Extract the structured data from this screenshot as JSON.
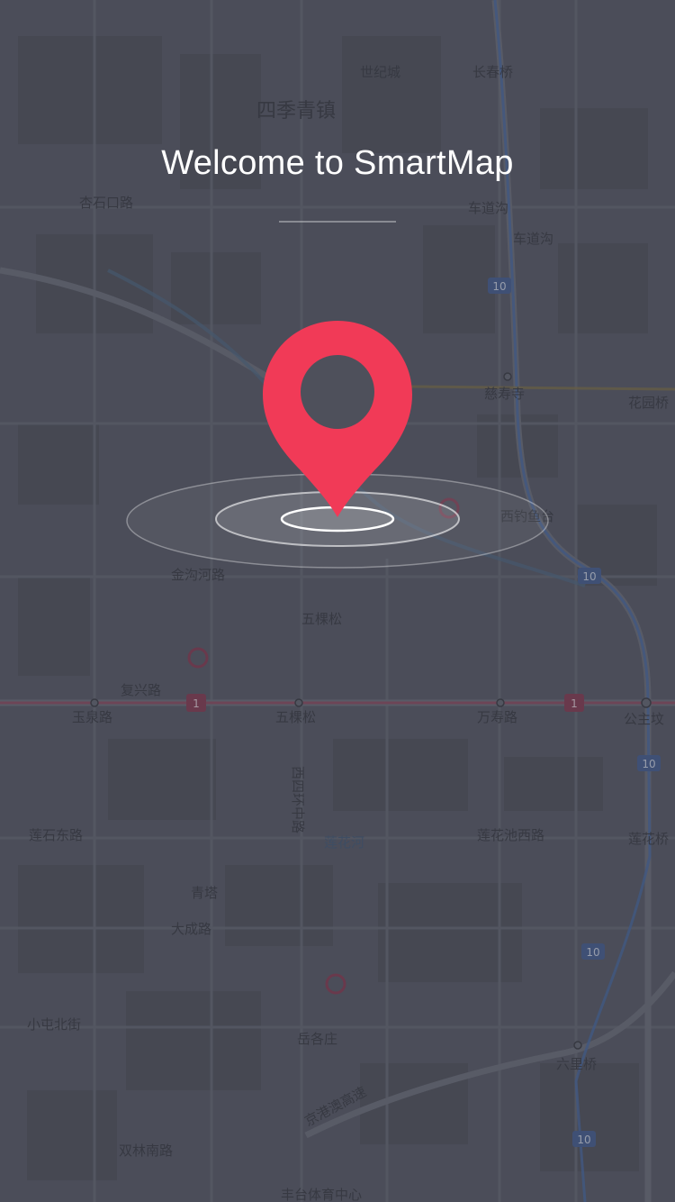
{
  "welcome": {
    "title": "Welcome to SmartMap"
  },
  "colors": {
    "pin": "#f13a57",
    "background": "#4c4e5a",
    "ring": "#ffffff"
  },
  "icons": {
    "pin": "location-pin-icon",
    "rings": "radar-rings-icon"
  },
  "map_labels": {
    "siji_qingzhen": "四季青镇",
    "shiji_cheng": "世纪城",
    "changchun_qiao": "长春桥",
    "chedaogou": "车道沟",
    "chedaogou_2": "车道沟",
    "cishousi": "慈寿寺",
    "huayuan_qiao": "花园桥",
    "xingshi_kou_lu": "杏石口路",
    "xidiaoyutai": "西钓鱼台",
    "jin_gou_he_lu": "金沟河路",
    "wukesong": "五棵松",
    "wukesong_station": "五棵松",
    "yuquan_lu": "玉泉路",
    "wanshou_lu": "万寿路",
    "gongzhufen": "公主坟",
    "fuxing_lu": "复兴路",
    "lianshi_dong_lu": "莲石东路",
    "lianhua_he": "莲花河",
    "lianhuachi_xi_lu": "莲花池西路",
    "lianhua_qiao": "莲花桥",
    "qingta": "青塔",
    "dacheng_lu": "大成路",
    "fengtai_tiyu_zhongxin": "丰台体育中心",
    "yuegezhuang": "岳各庄",
    "liuli_qiao": "六里桥",
    "shuanglin_nan_lu": "双林南路",
    "xiao_tun_bei_jie": "小屯北街",
    "jingshi_gaosu": "京港澳高速",
    "xisihuan_zhonglu": "西四环中路",
    "line1": "1",
    "line10a": "10",
    "line10b": "10",
    "line10c": "10",
    "line10d": "10",
    "line10e": "10"
  }
}
